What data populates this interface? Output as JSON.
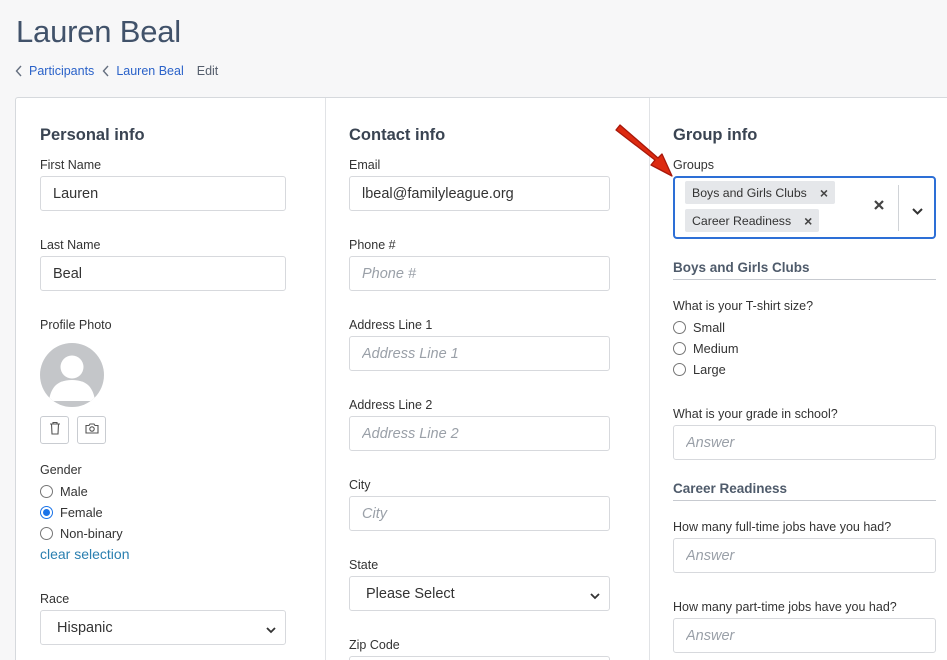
{
  "page": {
    "title": "Lauren Beal"
  },
  "breadcrumb": {
    "items": [
      "Participants",
      "Lauren Beal"
    ],
    "current": "Edit"
  },
  "personal": {
    "title": "Personal info",
    "first_name": {
      "label": "First Name",
      "value": "Lauren"
    },
    "last_name": {
      "label": "Last Name",
      "value": "Beal"
    },
    "photo_label": "Profile Photo",
    "gender": {
      "label": "Gender",
      "options": [
        "Male",
        "Female",
        "Non-binary"
      ],
      "selected": "Female"
    },
    "clear_selection": "clear selection",
    "race": {
      "label": "Race",
      "value": "Hispanic"
    }
  },
  "contact": {
    "title": "Contact info",
    "email": {
      "label": "Email",
      "value": "lbeal@familyleague.org"
    },
    "phone": {
      "label": "Phone #",
      "placeholder": "Phone #"
    },
    "address1": {
      "label": "Address Line 1",
      "placeholder": "Address Line 1"
    },
    "address2": {
      "label": "Address Line 2",
      "placeholder": "Address Line 2"
    },
    "city": {
      "label": "City",
      "placeholder": "City"
    },
    "state": {
      "label": "State",
      "value": "Please Select"
    },
    "zip": {
      "label": "Zip Code"
    }
  },
  "group": {
    "title": "Group info",
    "groups_label": "Groups",
    "tags": [
      "Boys and Girls Clubs",
      "Career Readiness"
    ],
    "sections": [
      {
        "title": "Boys and Girls Clubs",
        "tshirt": {
          "question": "What is your T-shirt size?",
          "options": [
            "Small",
            "Medium",
            "Large"
          ]
        },
        "grade": {
          "question": "What is your grade in school?",
          "placeholder": "Answer"
        }
      },
      {
        "title": "Career Readiness",
        "fulltime": {
          "question": "How many full-time jobs have you had?",
          "placeholder": "Answer"
        },
        "parttime": {
          "question": "How many part-time jobs have you had?",
          "placeholder": "Answer"
        }
      }
    ]
  },
  "colors": {
    "accent": "#2d6fd6",
    "link": "#2a62c9",
    "annotation_arrow": "#dd2a10"
  }
}
